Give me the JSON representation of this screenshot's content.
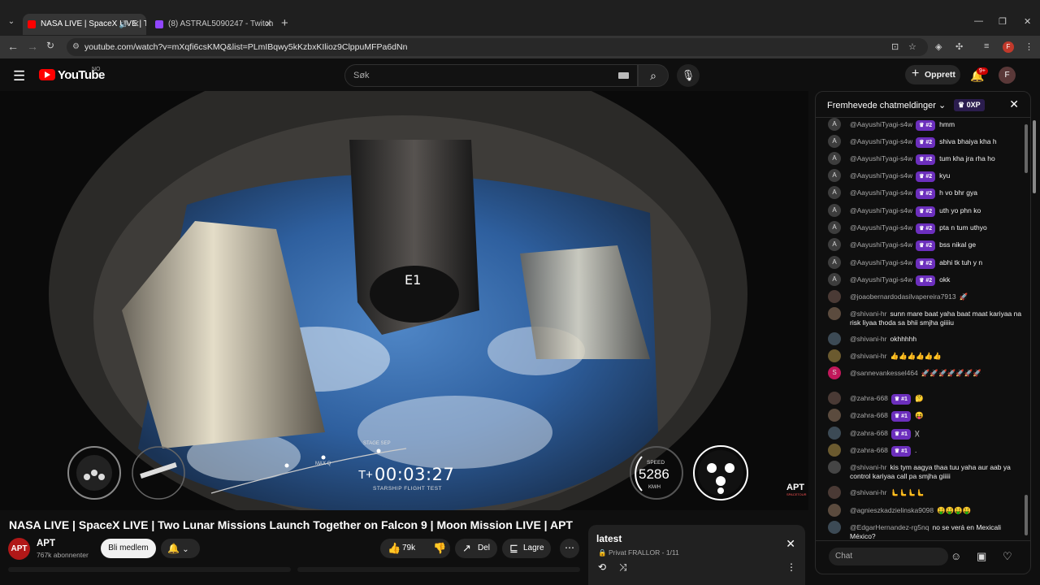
{
  "browser": {
    "tabs": [
      {
        "title": "NASA LIVE | SpaceX LIVE | T",
        "active": true,
        "favicon_color": "#ff0000"
      },
      {
        "title": "(8) ASTRAL5090247 - Twitch",
        "active": false,
        "favicon_color": "#9146ff"
      }
    ],
    "url": "youtube.com/watch?v=mXqfi6csKMQ&list=PLmIBqwy5kKzbxKIlioz9ClppuMFPa6dNn",
    "profile_initial": "F"
  },
  "youtube": {
    "logo_text": "YouTube",
    "country": "NO",
    "search_placeholder": "Søk",
    "create_label": "Opprett",
    "notif_badge": "9+",
    "avatar_initial": "F"
  },
  "video": {
    "title": "NASA LIVE | SpaceX LIVE | Two Lunar Missions Launch Together on Falcon 9 | Moon Mission LIVE | APT",
    "hud": {
      "t_prefix": "T+",
      "timer": "00:03:27",
      "caption": "STARSHIP FLIGHT TEST",
      "stage_label": "STAGE SEP",
      "maxq_label": "MAX Q",
      "speed_label": "SPEED",
      "speed_value": "5286",
      "speed_unit": "KM/H",
      "engine_label": "E1"
    },
    "watermark": "APT",
    "watermark_sub": "SPACETOUR",
    "channel": {
      "initial": "APT",
      "name": "APT",
      "subscribers": "767k abonnenter",
      "join_label": "Bli medlem"
    },
    "actions": {
      "likes": "79k",
      "share": "Del",
      "save": "Lagre"
    }
  },
  "chat": {
    "header": "Fremhevede chatmeldinger",
    "xp": "0XP",
    "input_placeholder": "Chat",
    "messages": [
      {
        "avatar": "A",
        "name": "@AayushiTyagi-s4w",
        "level": "#2",
        "text": "hmm"
      },
      {
        "avatar": "A",
        "name": "@AayushiTyagi-s4w",
        "level": "#2",
        "text": "shiva bhaiya kha h"
      },
      {
        "avatar": "A",
        "name": "@AayushiTyagi-s4w",
        "level": "#2",
        "text": "tum kha jra rha ho"
      },
      {
        "avatar": "A",
        "name": "@AayushiTyagi-s4w",
        "level": "#2",
        "text": "kyu"
      },
      {
        "avatar": "A",
        "name": "@AayushiTyagi-s4w",
        "level": "#2",
        "text": "h vo bhr gya"
      },
      {
        "avatar": "A",
        "name": "@AayushiTyagi-s4w",
        "level": "#2",
        "text": "uth yo phn ko"
      },
      {
        "avatar": "A",
        "name": "@AayushiTyagi-s4w",
        "level": "#2",
        "text": "pta n tum uthyo"
      },
      {
        "avatar": "A",
        "name": "@AayushiTyagi-s4w",
        "level": "#2",
        "text": "bss nikal ge"
      },
      {
        "avatar": "A",
        "name": "@AayushiTyagi-s4w",
        "level": "#2",
        "text": "abhi tk tuh y n"
      },
      {
        "avatar": "A",
        "name": "@AayushiTyagi-s4w",
        "level": "#2",
        "text": "okk"
      },
      {
        "avatar": "",
        "name": "@joaobernardodasilvapereira7913",
        "level": "",
        "text": "🚀"
      },
      {
        "avatar": "",
        "name": "@shivani-hr",
        "level": "",
        "text": "sunn mare baat yaha baat maat kariyaa na risk liyaa thoda sa bhii smjha giiiiu"
      },
      {
        "avatar": "",
        "name": "@shivani-hr",
        "level": "",
        "text": "okhhhhh"
      },
      {
        "avatar": "",
        "name": "@shivani-hr",
        "level": "",
        "text": "👍👍👍👍👍👍"
      },
      {
        "avatar": "S",
        "name": "@sannevankessel464",
        "level": "",
        "text": "🚀🚀🚀🚀🚀🚀🚀"
      },
      {
        "avatar": "",
        "name": "@zahra-668",
        "level": "#1",
        "text": "🤔"
      },
      {
        "avatar": "",
        "name": "@zahra-668",
        "level": "#1",
        "text": "😝"
      },
      {
        "avatar": "",
        "name": "@zahra-668",
        "level": "#1",
        "text": ")("
      },
      {
        "avatar": "",
        "name": "@zahra-668",
        "level": "#1",
        "text": "."
      },
      {
        "avatar": "",
        "name": "@shivani-hr",
        "level": "",
        "text": "kis tym aagya thaa tuu yaha aur aab ya control kariyaa call pa smjha giiiii"
      },
      {
        "avatar": "",
        "name": "@shivani-hr",
        "level": "",
        "text": "🫷🫷🫷🫷"
      },
      {
        "avatar": "",
        "name": "@agnieszkadzielinska9098",
        "level": "",
        "text": "🤑🤑🤑🤑"
      },
      {
        "avatar": "",
        "name": "@EdgarHernandez-rg5nq",
        "level": "",
        "text": "no se verá en Mexicali México?"
      }
    ]
  },
  "playlist": {
    "title": "latest",
    "subtitle": "Privat FRALLOR - 1/11"
  }
}
